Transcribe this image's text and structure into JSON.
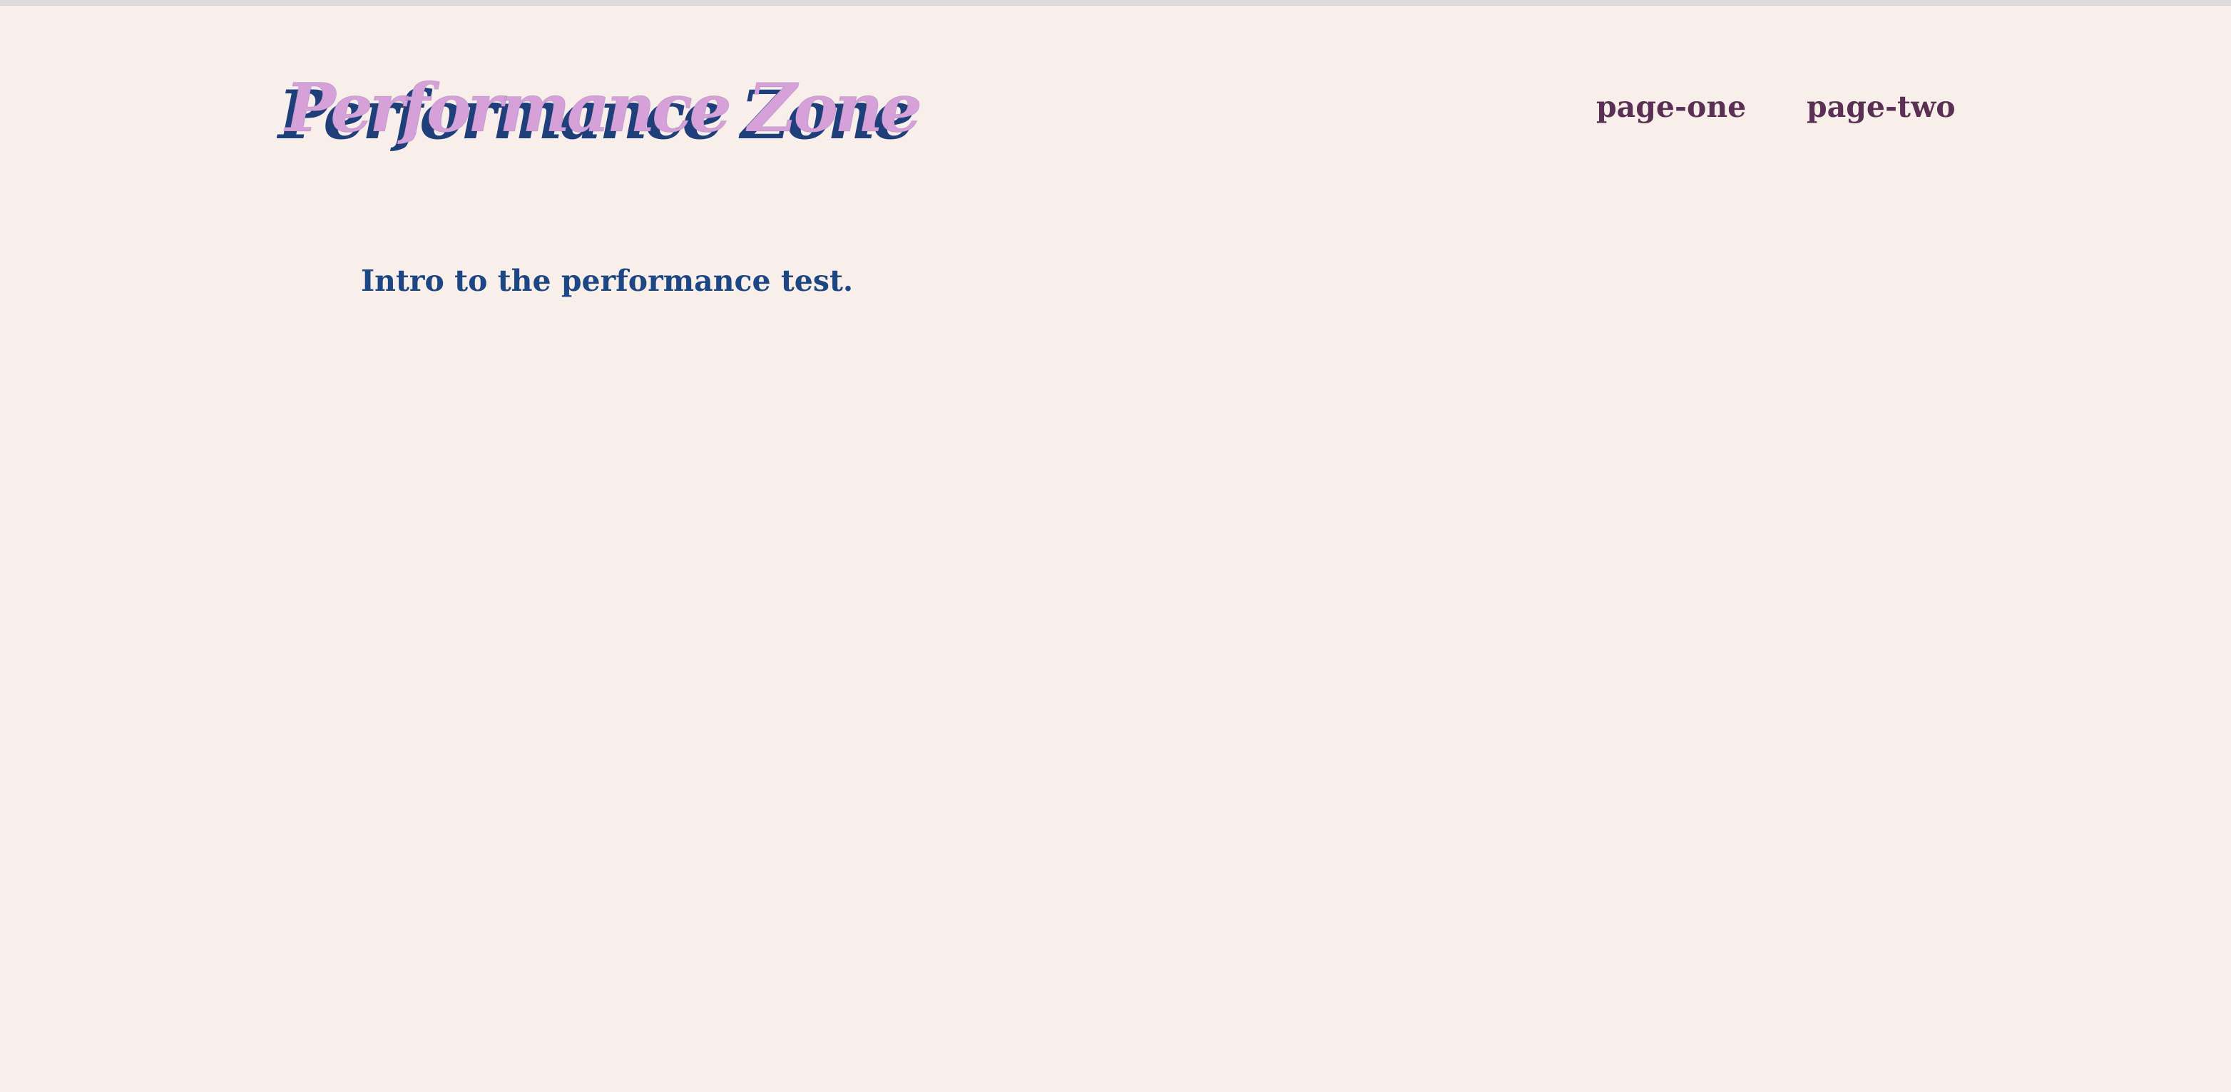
{
  "site": {
    "title": "Performance Zone"
  },
  "nav": {
    "items": [
      {
        "label": "page-one"
      },
      {
        "label": "page-two"
      }
    ]
  },
  "main": {
    "intro_text": "Intro to the performance test."
  },
  "colors": {
    "background": "#f9efea",
    "title_front": "#d6a0d8",
    "title_shadow": "#1f3f7a",
    "nav_text": "#5a3155",
    "intro_text": "#1c4784"
  }
}
